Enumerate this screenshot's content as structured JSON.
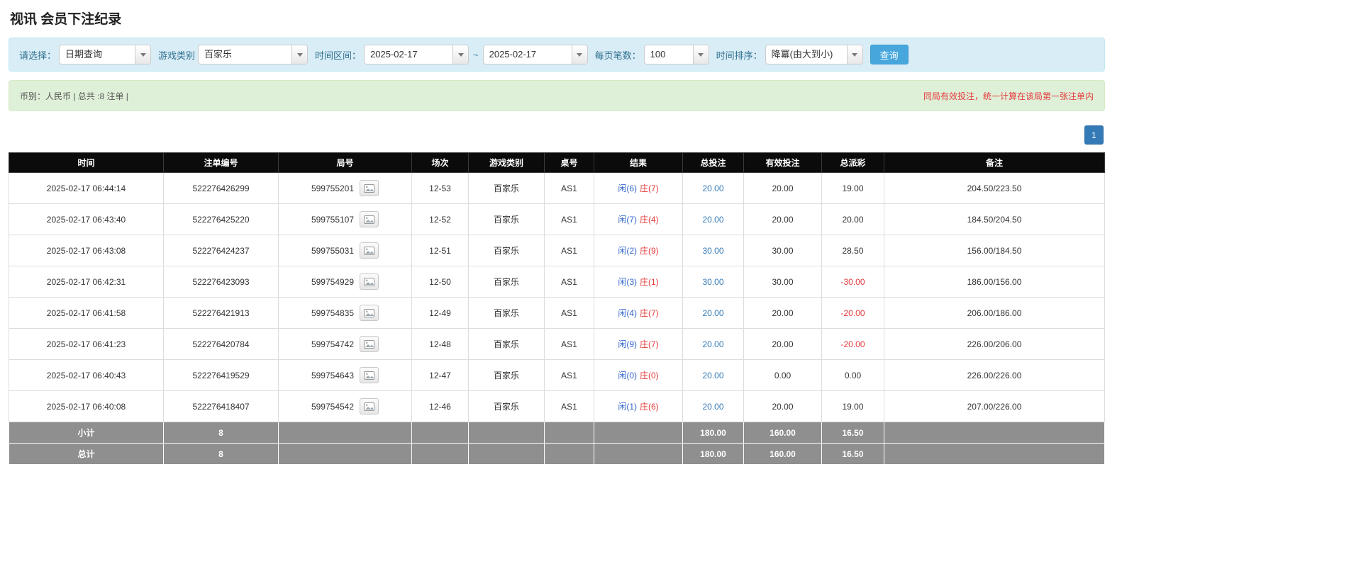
{
  "page": {
    "title": "视讯 会员下注纪录"
  },
  "filters": {
    "select_label": "请选择：",
    "select_value": "日期查询",
    "game_type_label": "游戏类别",
    "game_type_value": "百家乐",
    "time_range_label": "时间区间：",
    "date_from": "2025-02-17",
    "tilde": "~",
    "date_to": "2025-02-17",
    "page_size_label": "每页笔数：",
    "page_size_value": "100",
    "sort_label": "时间排序：",
    "sort_value": "降冪(由大到小)",
    "search_button": "查询"
  },
  "summary": {
    "left": "币别：人民币 | 总共 :8 注单 |",
    "right": "同局有效投注，统一计算在该局第一张注单内"
  },
  "pagination": {
    "current_page": "1"
  },
  "table": {
    "headers": [
      "时间",
      "注单编号",
      "局号",
      "场次",
      "游戏类别",
      "桌号",
      "结果",
      "总投注",
      "有效投注",
      "总派彩",
      "备注"
    ],
    "rows": [
      {
        "time": "2025-02-17 06:44:14",
        "bet_id": "522276426299",
        "round_id": "599755201",
        "session": "12-53",
        "game": "百家乐",
        "table_no": "AS1",
        "result_player": "闲(6)",
        "result_banker": "庄(7)",
        "total_bet": "20.00",
        "valid_bet": "20.00",
        "payout": "19.00",
        "remark": "204.50/223.50"
      },
      {
        "time": "2025-02-17 06:43:40",
        "bet_id": "522276425220",
        "round_id": "599755107",
        "session": "12-52",
        "game": "百家乐",
        "table_no": "AS1",
        "result_player": "闲(7)",
        "result_banker": "庄(4)",
        "total_bet": "20.00",
        "valid_bet": "20.00",
        "payout": "20.00",
        "remark": "184.50/204.50"
      },
      {
        "time": "2025-02-17 06:43:08",
        "bet_id": "522276424237",
        "round_id": "599755031",
        "session": "12-51",
        "game": "百家乐",
        "table_no": "AS1",
        "result_player": "闲(2)",
        "result_banker": "庄(9)",
        "total_bet": "30.00",
        "valid_bet": "30.00",
        "payout": "28.50",
        "remark": "156.00/184.50"
      },
      {
        "time": "2025-02-17 06:42:31",
        "bet_id": "522276423093",
        "round_id": "599754929",
        "session": "12-50",
        "game": "百家乐",
        "table_no": "AS1",
        "result_player": "闲(3)",
        "result_banker": "庄(1)",
        "total_bet": "30.00",
        "valid_bet": "30.00",
        "payout": "-30.00",
        "remark": "186.00/156.00"
      },
      {
        "time": "2025-02-17 06:41:58",
        "bet_id": "522276421913",
        "round_id": "599754835",
        "session": "12-49",
        "game": "百家乐",
        "table_no": "AS1",
        "result_player": "闲(4)",
        "result_banker": "庄(7)",
        "total_bet": "20.00",
        "valid_bet": "20.00",
        "payout": "-20.00",
        "remark": "206.00/186.00"
      },
      {
        "time": "2025-02-17 06:41:23",
        "bet_id": "522276420784",
        "round_id": "599754742",
        "session": "12-48",
        "game": "百家乐",
        "table_no": "AS1",
        "result_player": "闲(9)",
        "result_banker": "庄(7)",
        "total_bet": "20.00",
        "valid_bet": "20.00",
        "payout": "-20.00",
        "remark": "226.00/206.00"
      },
      {
        "time": "2025-02-17 06:40:43",
        "bet_id": "522276419529",
        "round_id": "599754643",
        "session": "12-47",
        "game": "百家乐",
        "table_no": "AS1",
        "result_player": "闲(0)",
        "result_banker": "庄(0)",
        "total_bet": "20.00",
        "valid_bet": "0.00",
        "payout": "0.00",
        "remark": "226.00/226.00"
      },
      {
        "time": "2025-02-17 06:40:08",
        "bet_id": "522276418407",
        "round_id": "599754542",
        "session": "12-46",
        "game": "百家乐",
        "table_no": "AS1",
        "result_player": "闲(1)",
        "result_banker": "庄(6)",
        "total_bet": "20.00",
        "valid_bet": "20.00",
        "payout": "19.00",
        "remark": "207.00/226.00"
      }
    ],
    "subtotal": {
      "label": "小计",
      "count": "8",
      "total_bet": "180.00",
      "valid_bet": "160.00",
      "payout": "16.50"
    },
    "total": {
      "label": "总计",
      "count": "8",
      "total_bet": "180.00",
      "valid_bet": "160.00",
      "payout": "16.50"
    }
  },
  "icons": {
    "dropdown": "chevron-down-icon",
    "round_preview": "cards-icon"
  },
  "colors": {
    "accent": "#337ab7",
    "accent-light": "#47a7dc",
    "info-bg": "#d9edf7",
    "info-border": "#bce8f1",
    "info-text": "#31708f",
    "success-bg": "#dff0d8",
    "success-border": "#d6e9c6",
    "danger": "#e4393c",
    "header-bg": "#0b0b0b",
    "footer-bg": "#8f8f8f",
    "player-blue": "#3366cc",
    "banker-red": "#e43a3a"
  }
}
